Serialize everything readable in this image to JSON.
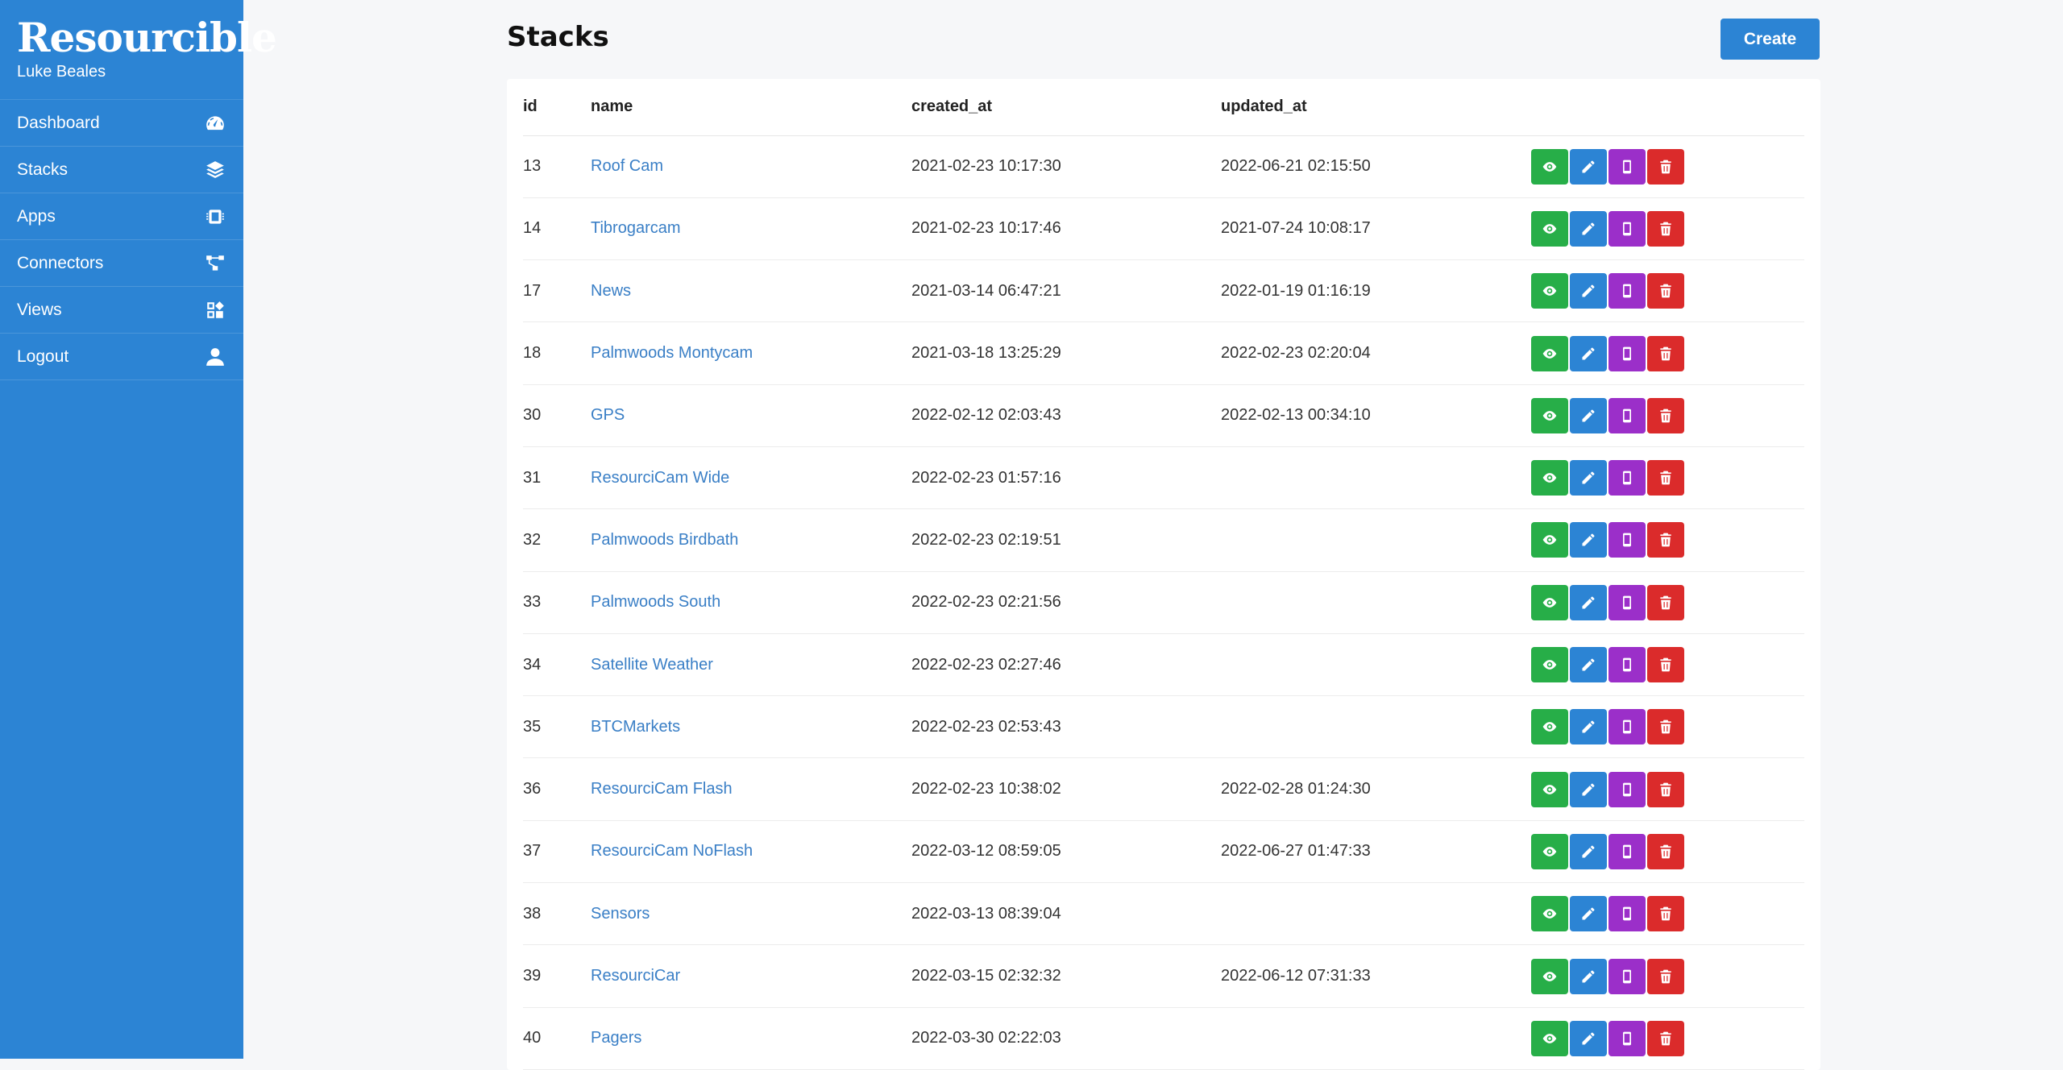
{
  "sidebar": {
    "brand": "Resourcible",
    "user": "Luke Beales",
    "items": [
      {
        "label": "Dashboard",
        "icon": "gauge-icon"
      },
      {
        "label": "Stacks",
        "icon": "layers-icon"
      },
      {
        "label": "Apps",
        "icon": "chip-icon"
      },
      {
        "label": "Connectors",
        "icon": "network-icon"
      },
      {
        "label": "Views",
        "icon": "widgets-icon"
      },
      {
        "label": "Logout",
        "icon": "user-icon"
      }
    ]
  },
  "header": {
    "title": "Stacks",
    "create_label": "Create"
  },
  "table": {
    "columns": [
      "id",
      "name",
      "created_at",
      "updated_at"
    ],
    "rows": [
      {
        "id": "13",
        "name": "Roof Cam",
        "created_at": "2021-02-23 10:17:30",
        "updated_at": "2022-06-21 02:15:50"
      },
      {
        "id": "14",
        "name": "Tibrogarcam",
        "created_at": "2021-02-23 10:17:46",
        "updated_at": "2021-07-24 10:08:17"
      },
      {
        "id": "17",
        "name": "News",
        "created_at": "2021-03-14 06:47:21",
        "updated_at": "2022-01-19 01:16:19"
      },
      {
        "id": "18",
        "name": "Palmwoods Montycam",
        "created_at": "2021-03-18 13:25:29",
        "updated_at": "2022-02-23 02:20:04"
      },
      {
        "id": "30",
        "name": "GPS",
        "created_at": "2022-02-12 02:03:43",
        "updated_at": "2022-02-13 00:34:10"
      },
      {
        "id": "31",
        "name": "ResourciCam Wide",
        "created_at": "2022-02-23 01:57:16",
        "updated_at": ""
      },
      {
        "id": "32",
        "name": "Palmwoods Birdbath",
        "created_at": "2022-02-23 02:19:51",
        "updated_at": ""
      },
      {
        "id": "33",
        "name": "Palmwoods South",
        "created_at": "2022-02-23 02:21:56",
        "updated_at": ""
      },
      {
        "id": "34",
        "name": "Satellite Weather",
        "created_at": "2022-02-23 02:27:46",
        "updated_at": ""
      },
      {
        "id": "35",
        "name": "BTCMarkets",
        "created_at": "2022-02-23 02:53:43",
        "updated_at": ""
      },
      {
        "id": "36",
        "name": "ResourciCam Flash",
        "created_at": "2022-02-23 10:38:02",
        "updated_at": "2022-02-28 01:24:30"
      },
      {
        "id": "37",
        "name": "ResourciCam NoFlash",
        "created_at": "2022-03-12 08:59:05",
        "updated_at": "2022-06-27 01:47:33"
      },
      {
        "id": "38",
        "name": "Sensors",
        "created_at": "2022-03-13 08:39:04",
        "updated_at": ""
      },
      {
        "id": "39",
        "name": "ResourciCar",
        "created_at": "2022-03-15 02:32:32",
        "updated_at": "2022-06-12 07:31:33"
      },
      {
        "id": "40",
        "name": "Pagers",
        "created_at": "2022-03-30 02:22:03",
        "updated_at": ""
      }
    ],
    "actions": [
      "eye-icon",
      "pencil-icon",
      "mobile-icon",
      "trash-icon"
    ]
  },
  "colors": {
    "primary": "#2c84d4",
    "view": "#27ae48",
    "mobile": "#9b2fc9",
    "delete": "#db2b2b"
  }
}
